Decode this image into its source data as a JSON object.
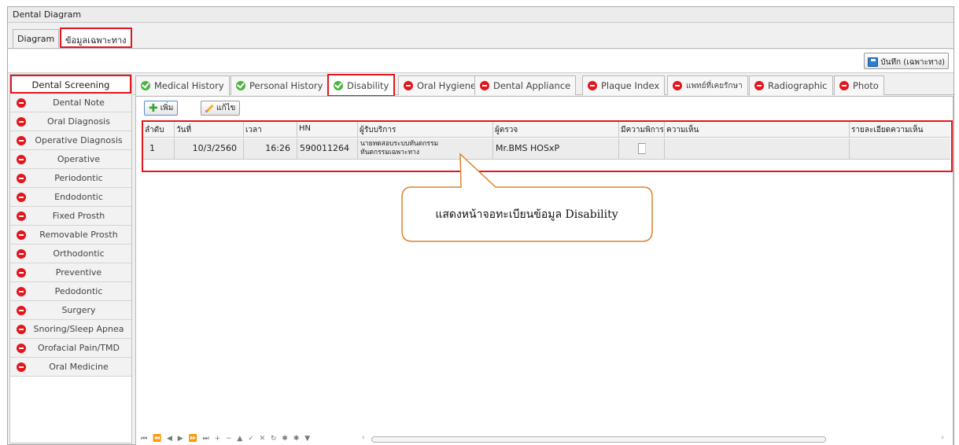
{
  "window": {
    "title": "Dental Diagram"
  },
  "top_tabs": [
    {
      "label": "Diagram",
      "active": false
    },
    {
      "label": "ข้อมูลเฉพาะทาง",
      "active": true
    }
  ],
  "toolbar": {
    "save_label": "บันทึก (เฉพาะทาง)",
    "save_icon": "floppy-disk-icon"
  },
  "sidebar": {
    "header": "Dental Screening",
    "items": [
      {
        "label": "Dental Note",
        "status": "red"
      },
      {
        "label": "Oral Diagnosis",
        "status": "red"
      },
      {
        "label": "Operative Diagnosis",
        "status": "red"
      },
      {
        "label": "Operative",
        "status": "red"
      },
      {
        "label": "Periodontic",
        "status": "red"
      },
      {
        "label": "Endodontic",
        "status": "red"
      },
      {
        "label": "Fixed Prosth",
        "status": "red"
      },
      {
        "label": "Removable Prosth",
        "status": "red"
      },
      {
        "label": "Orthodontic",
        "status": "red"
      },
      {
        "label": "Preventive",
        "status": "red"
      },
      {
        "label": "Pedodontic",
        "status": "red"
      },
      {
        "label": "Surgery",
        "status": "red"
      },
      {
        "label": "Snoring/Sleep Apnea",
        "status": "red"
      },
      {
        "label": "Orofacial Pain/TMD",
        "status": "red"
      },
      {
        "label": "Oral Medicine",
        "status": "red"
      }
    ]
  },
  "sub_tabs": [
    {
      "label": "Medical History",
      "status": "green",
      "active": false
    },
    {
      "label": "Personal History",
      "status": "green",
      "active": false
    },
    {
      "label": "Disability",
      "status": "green",
      "active": true
    },
    {
      "label": "Oral Hygiene",
      "status": "red",
      "active": false
    },
    {
      "label": "Dental Appliance",
      "status": "red",
      "active": false
    },
    {
      "label": "Plaque Index",
      "status": "red",
      "active": false
    },
    {
      "label": "แพทย์ที่เคยรักษา",
      "status": "red",
      "active": false
    },
    {
      "label": "Radiographic",
      "status": "red",
      "active": false
    },
    {
      "label": "Photo",
      "status": "red",
      "active": false
    }
  ],
  "actions": {
    "add_label": "เพิ่ม",
    "edit_label": "แก้ไข"
  },
  "grid": {
    "headers": [
      "ลำดับ",
      "วันที่",
      "เวลา",
      "HN",
      "ผู้รับบริการ",
      "ผู้ตรวจ",
      "มีความพิการ",
      "ความเห็น",
      "รายละเอียดความเห็น"
    ],
    "rows": [
      {
        "no": "1",
        "date": "10/3/2560",
        "time": "16:26",
        "hn": "590011264",
        "patient_line1": "นายทดสอบระบบทันตกรรม",
        "patient_line2": "ทันตกรรมเฉพาะทาง",
        "examiner": "Mr.BMS HOSxP",
        "disabled": false,
        "comment": "",
        "comment_detail": ""
      }
    ]
  },
  "callout": {
    "text": "แสดงหน้าจอทะเบียนข้อมูล Disability"
  },
  "navigator": {
    "buttons": "⏮ ⏪ ◀ ▶ ⏩ ⏭ + − ▲ ✓ ✕ ↻ ✱ ✱ ▼"
  },
  "colors": {
    "highlight": "#e3161e",
    "ok": "#4cb541",
    "missing": "#e3161e"
  }
}
